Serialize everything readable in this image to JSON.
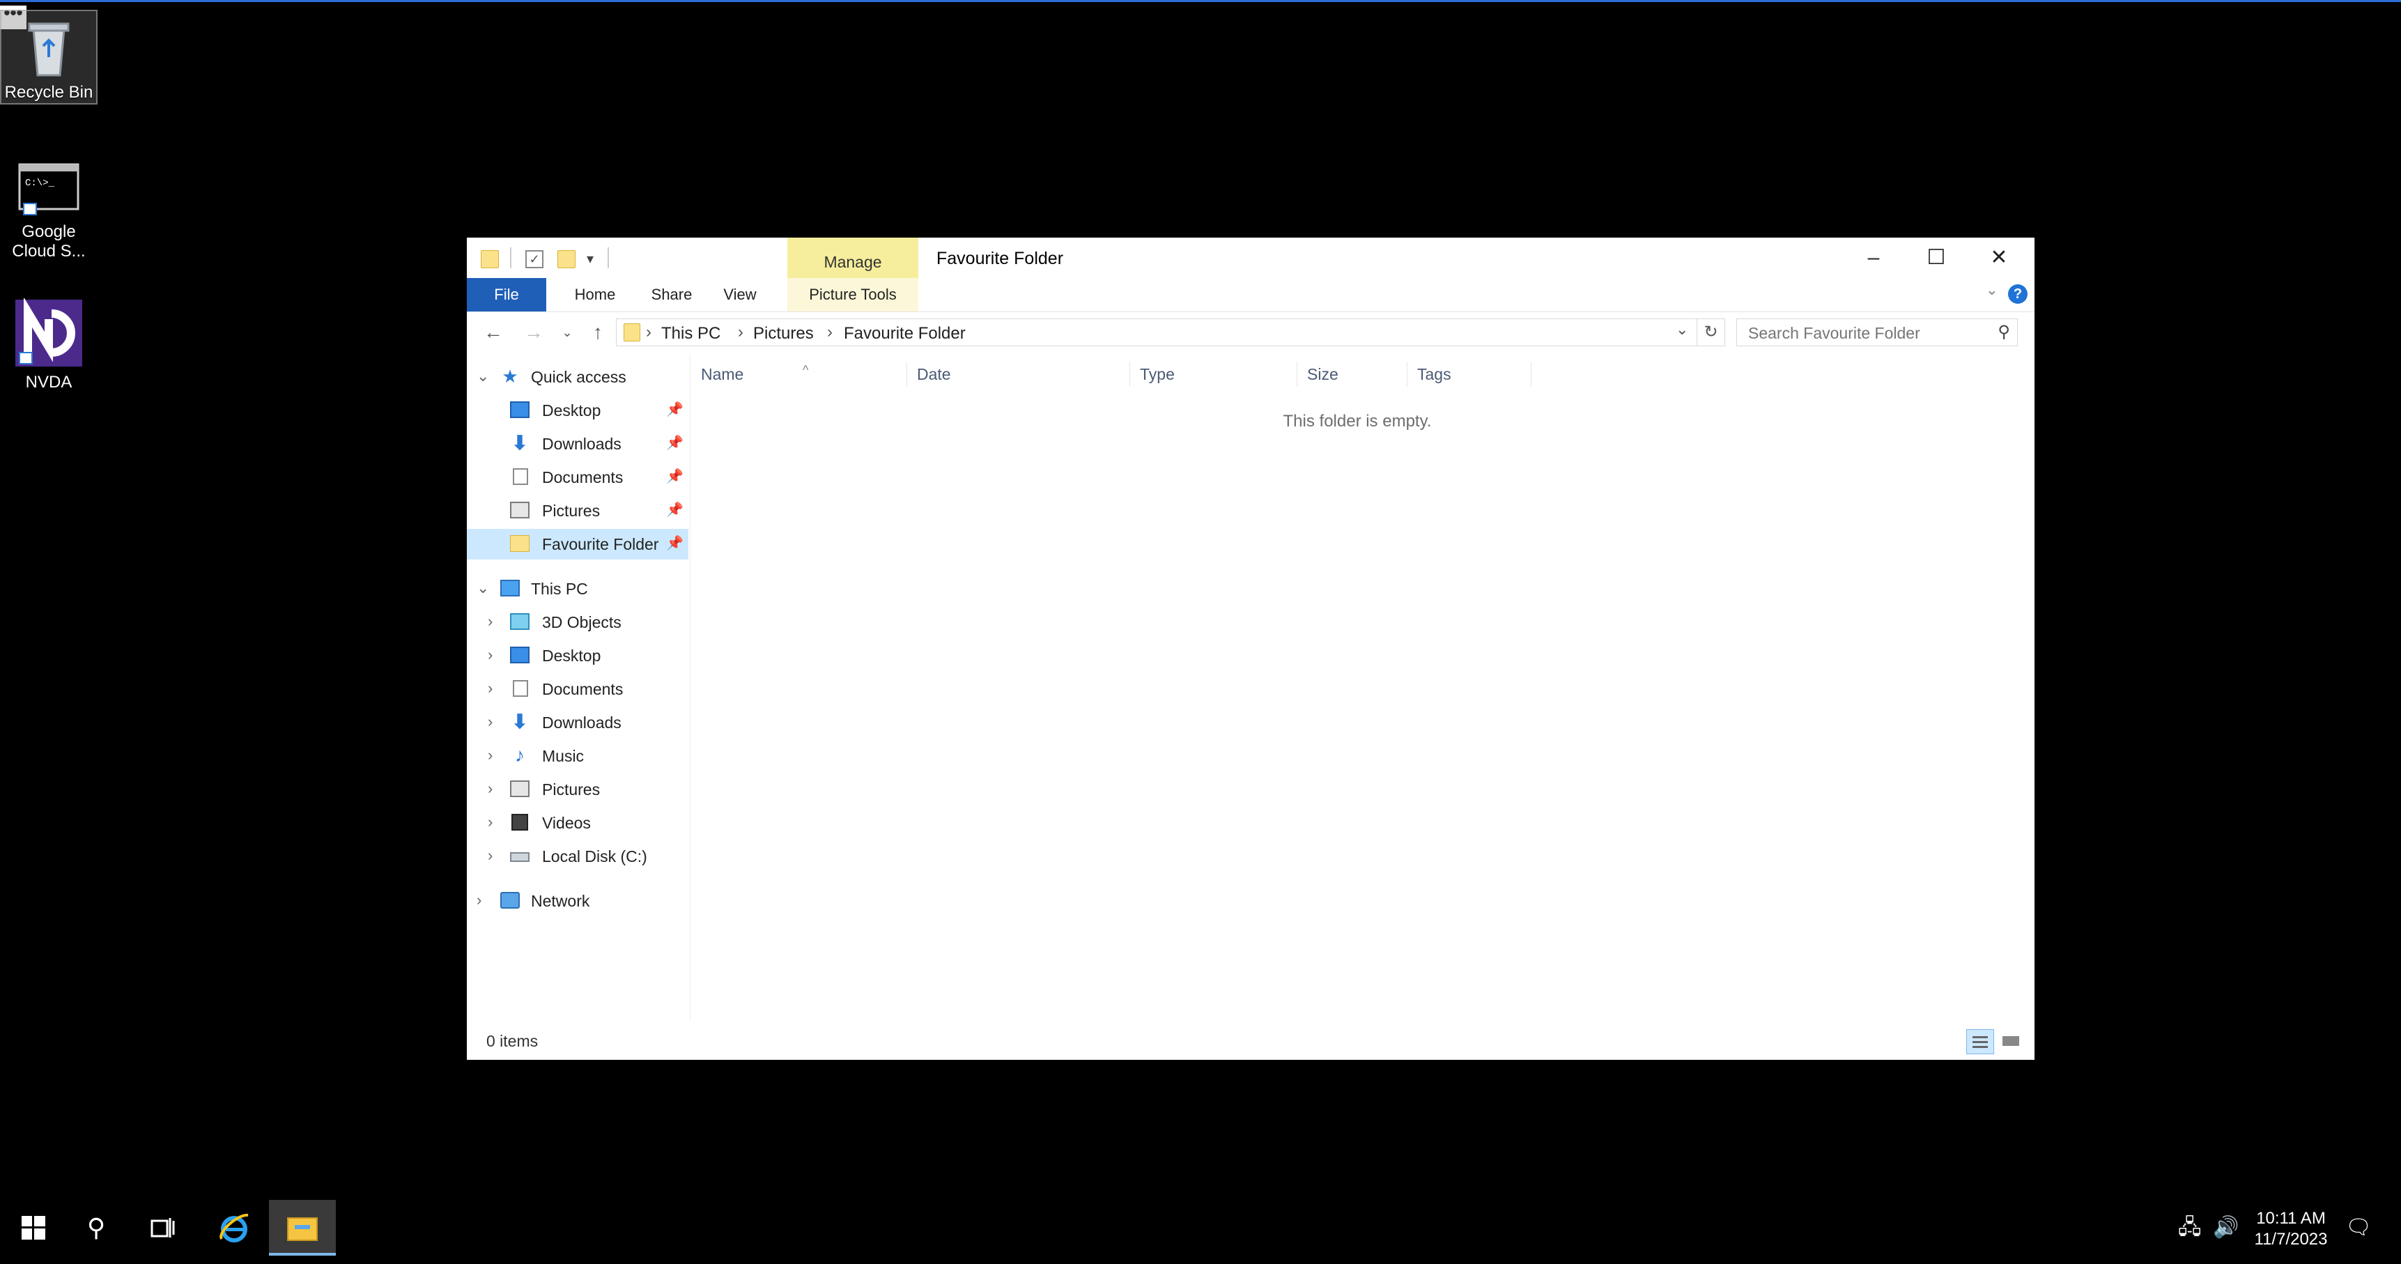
{
  "desktop": {
    "icons": [
      {
        "label": "Recycle Bin"
      },
      {
        "label": "Google Cloud S..."
      },
      {
        "label": "NVDA"
      }
    ]
  },
  "window": {
    "title": "Favourite Folder",
    "contextual_tab_group": "Manage",
    "tabs": [
      "File",
      "Home",
      "Share",
      "View",
      "Picture Tools"
    ],
    "breadcrumb": [
      "This PC",
      "Pictures",
      "Favourite Folder"
    ],
    "search_placeholder": "Search Favourite Folder",
    "columns": [
      "Name",
      "Date",
      "Type",
      "Size",
      "Tags"
    ],
    "empty_message": "This folder is empty.",
    "status": "0 items"
  },
  "navpane": {
    "quick_access": {
      "label": "Quick access",
      "items": [
        {
          "label": "Desktop",
          "icon": "desktop-icon",
          "pinned": true
        },
        {
          "label": "Downloads",
          "icon": "downloads-icon",
          "pinned": true
        },
        {
          "label": "Documents",
          "icon": "documents-icon",
          "pinned": true
        },
        {
          "label": "Pictures",
          "icon": "pictures-icon",
          "pinned": true
        },
        {
          "label": "Favourite Folder",
          "icon": "folder-icon",
          "pinned": true,
          "selected": true
        }
      ]
    },
    "this_pc": {
      "label": "This PC",
      "items": [
        {
          "label": "3D Objects",
          "icon": "3d-objects-icon"
        },
        {
          "label": "Desktop",
          "icon": "desktop-icon"
        },
        {
          "label": "Documents",
          "icon": "documents-icon"
        },
        {
          "label": "Downloads",
          "icon": "downloads-icon"
        },
        {
          "label": "Music",
          "icon": "music-icon"
        },
        {
          "label": "Pictures",
          "icon": "pictures-icon"
        },
        {
          "label": "Videos",
          "icon": "videos-icon"
        },
        {
          "label": "Local Disk (C:)",
          "icon": "local-disk-icon"
        }
      ]
    },
    "network": {
      "label": "Network"
    }
  },
  "taskbar": {
    "time": "10:11 AM",
    "date": "11/7/2023"
  },
  "colors": {
    "accent": "#1f5fb8",
    "manage_tab": "#f6ee9c",
    "selection": "#cce8ff"
  }
}
